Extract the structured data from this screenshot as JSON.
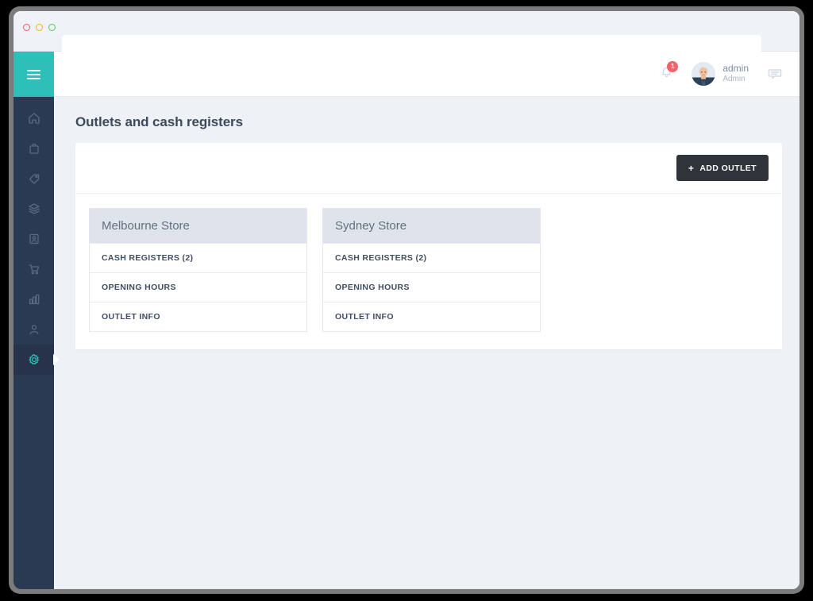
{
  "browser": {
    "traffic_lights": [
      "close",
      "minimize",
      "maximize"
    ],
    "url_value": "",
    "url_placeholder": ""
  },
  "sidebar": {
    "logo_icon": "hamburger-menu-icon",
    "items": [
      {
        "icon": "home-icon",
        "label": "Home",
        "active": false
      },
      {
        "icon": "briefcase-icon",
        "label": "Products",
        "active": false
      },
      {
        "icon": "tag-icon",
        "label": "Pricing",
        "active": false
      },
      {
        "icon": "layers-icon",
        "label": "Inventory",
        "active": false
      },
      {
        "icon": "contact-icon",
        "label": "Customers",
        "active": false
      },
      {
        "icon": "cart-icon",
        "label": "Sales",
        "active": false
      },
      {
        "icon": "bar-chart-icon",
        "label": "Reports",
        "active": false
      },
      {
        "icon": "user-icon",
        "label": "Users",
        "active": false
      },
      {
        "icon": "gear-icon",
        "label": "Settings",
        "active": true
      }
    ]
  },
  "header": {
    "notifications": {
      "icon": "bell-icon",
      "count": "1"
    },
    "user": {
      "avatar_icon": "avatar",
      "name": "admin",
      "role": "Admin"
    },
    "chat_icon": "chat-icon"
  },
  "page": {
    "title": "Outlets and cash registers"
  },
  "toolbar": {
    "add_outlet_label": "ADD OUTLET",
    "add_outlet_icon": "plus-icon",
    "plus_glyph": "+"
  },
  "outlets": [
    {
      "name": "Melbourne Store",
      "rows": [
        "CASH REGISTERS (2)",
        "OPENING HOURS",
        "OUTLET INFO"
      ]
    },
    {
      "name": "Sydney Store",
      "rows": [
        "CASH REGISTERS (2)",
        "OPENING HOURS",
        "OUTLET INFO"
      ]
    }
  ],
  "colors": {
    "accent_teal": "#2ebfb9",
    "sidebar_navy": "#2b3a53",
    "badge_red": "#f2636b",
    "button_dark": "#2f343b",
    "page_bg": "#eef1f5",
    "card_header": "#dfe3ec"
  }
}
